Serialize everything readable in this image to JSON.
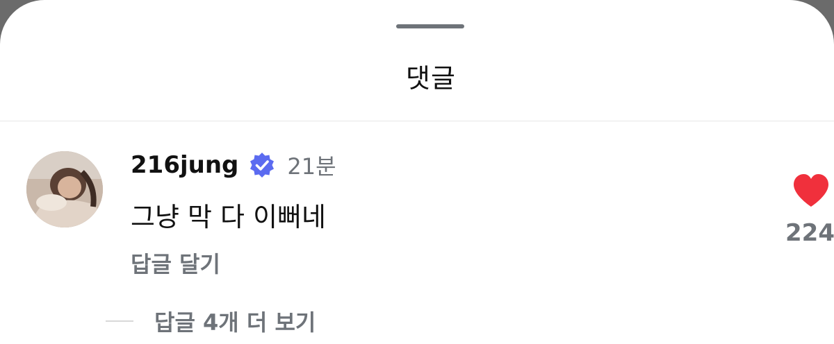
{
  "sheet": {
    "title": "댓글"
  },
  "comment": {
    "username": "216jung",
    "verified": true,
    "timestamp": "21분",
    "text": "그냥 막 다 이뻐네",
    "reply_label": "답글 달기",
    "like_count": "224",
    "liked": true,
    "more_replies_label": "답글 4개 더 보기"
  },
  "colors": {
    "verified_badge": "#5b6bf0",
    "heart": "#f0303c",
    "secondary_text": "#6e7379"
  },
  "icons": {
    "verified": "verified-badge-icon",
    "like": "heart-icon"
  }
}
